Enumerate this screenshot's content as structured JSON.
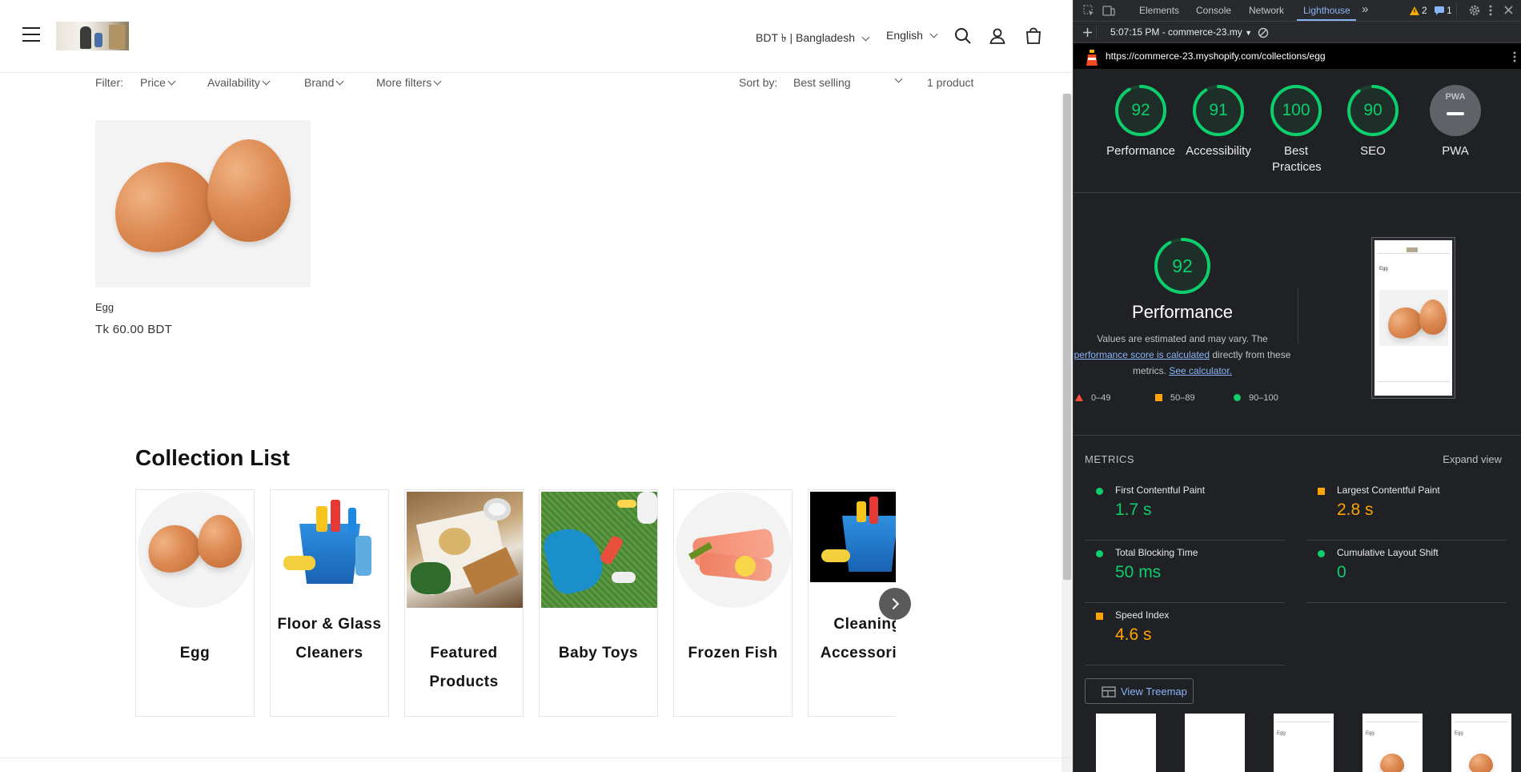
{
  "store": {
    "header": {
      "menu_icon": "hamburger-menu-icon",
      "logo_alt": "store-logo",
      "currency": "BDT ৳ | Bangladesh",
      "language": "English",
      "icons": [
        "search-icon",
        "account-icon",
        "cart-icon"
      ]
    },
    "filters": {
      "label": "Filter:",
      "items": [
        "Price",
        "Availability",
        "Brand",
        "More filters"
      ],
      "sort_label": "Sort by:",
      "sort_value": "Best selling",
      "count": "1 product"
    },
    "product": {
      "title": "Egg",
      "price": "Tk 60.00 BDT"
    },
    "collection": {
      "title": "Collection List",
      "items": [
        {
          "label": "Egg",
          "line2": ""
        },
        {
          "label": "Floor & Glass",
          "line2": "Cleaners"
        },
        {
          "label": "Featured",
          "line2": "Products"
        },
        {
          "label": "Baby Toys",
          "line2": ""
        },
        {
          "label": "Frozen Fish",
          "line2": ""
        },
        {
          "label": "Cleaning",
          "line2": "Accessories"
        }
      ],
      "next_icon": "chevron-right-icon"
    }
  },
  "devtools": {
    "tabs": [
      "Elements",
      "Console",
      "Network",
      "Lighthouse"
    ],
    "active_tab": "Lighthouse",
    "more_tabs": "»",
    "warnings": "2",
    "messages": "1",
    "report_select": "5:07:15 PM - commerce-23.my",
    "url": "https://commerce-23.myshopify.com/collections/egg",
    "scores": [
      {
        "value": 92,
        "label": "Performance"
      },
      {
        "value": 91,
        "label": "Accessibility"
      },
      {
        "value": 100,
        "label": "Best Practices"
      },
      {
        "value": 90,
        "label": "SEO"
      }
    ],
    "pwa_label": "PWA",
    "pwa_badge": "PWA",
    "performance": {
      "score": 92,
      "title": "Performance",
      "desc_1": "Values are estimated and may vary. The",
      "desc_link_1": "performance score is calculated",
      "desc_2": "directly from these metrics.",
      "desc_link_2": "See calculator.",
      "legend": [
        "0–49",
        "50–89",
        "90–100"
      ]
    },
    "thumbnail": {
      "title": "Egg"
    },
    "metrics_header": "METRICS",
    "expand_label": "Expand view",
    "metrics": [
      {
        "label": "First Contentful Paint",
        "value": "1.7 s",
        "status": "pass"
      },
      {
        "label": "Largest Contentful Paint",
        "value": "2.8 s",
        "status": "average"
      },
      {
        "label": "Total Blocking Time",
        "value": "50 ms",
        "status": "pass"
      },
      {
        "label": "Cumulative Layout Shift",
        "value": "0",
        "status": "pass"
      },
      {
        "label": "Speed Index",
        "value": "4.6 s",
        "status": "average"
      }
    ],
    "treemap_label": "View Treemap",
    "colors": {
      "pass": "#0cce6b",
      "average": "#ffa400",
      "fail": "#ff4e42",
      "link": "#8ab4f8"
    }
  }
}
